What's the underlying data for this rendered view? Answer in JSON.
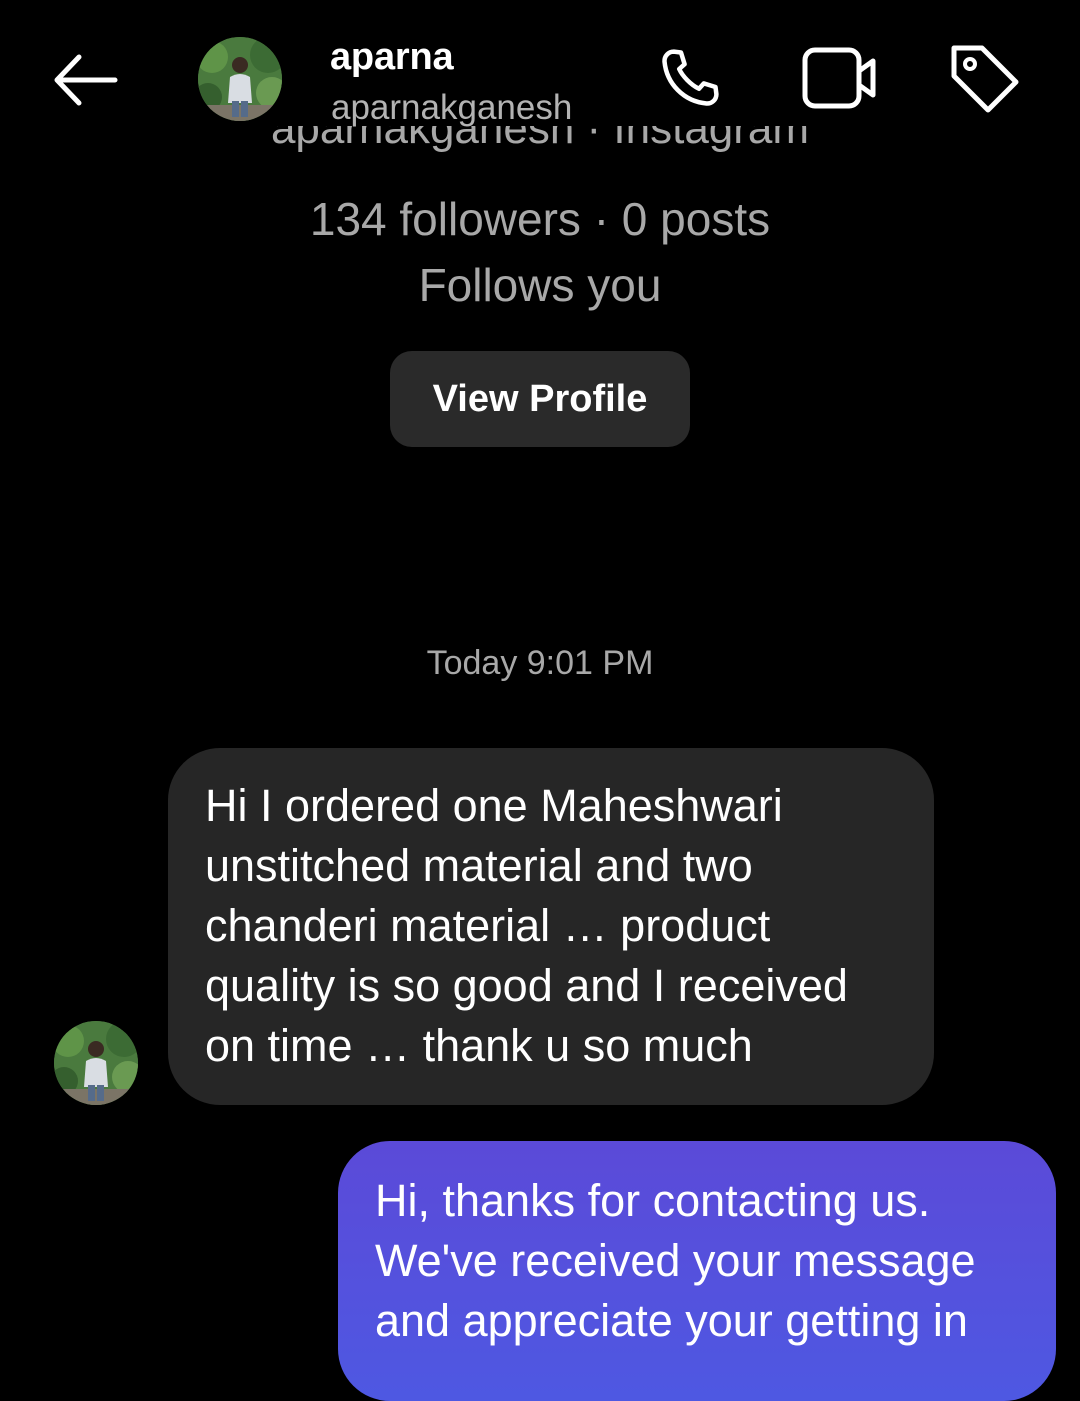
{
  "header": {
    "name": "aparna",
    "username": "aparnakganesh",
    "back_icon": "arrow-left-icon",
    "call_icon": "phone-icon",
    "video_icon": "video-camera-icon",
    "tag_icon": "tag-icon"
  },
  "profile": {
    "clipped_line": "aparnakganesh · Instagram",
    "stats": "134 followers · 0 posts",
    "follows_you": "Follows you",
    "view_profile_label": "View Profile"
  },
  "thread": {
    "timestamp": "Today 9:01 PM",
    "messages": [
      {
        "direction": "incoming",
        "lines": [
          "Hi I ordered one Maheshwari",
          "unstitched material and two",
          "chanderi material … product",
          "quality is so good and I received",
          "on time … thank u so much"
        ]
      },
      {
        "direction": "outgoing",
        "lines": [
          "Hi, thanks for contacting us.",
          "We've received your message",
          "and appreciate your getting in"
        ]
      }
    ]
  },
  "colors": {
    "background": "#000000",
    "incoming_bubble": "#262626",
    "outgoing_bubble_top": "#5b4ad8",
    "outgoing_bubble_bottom": "#4e58e2",
    "secondary_text": "#a8a8a8"
  }
}
